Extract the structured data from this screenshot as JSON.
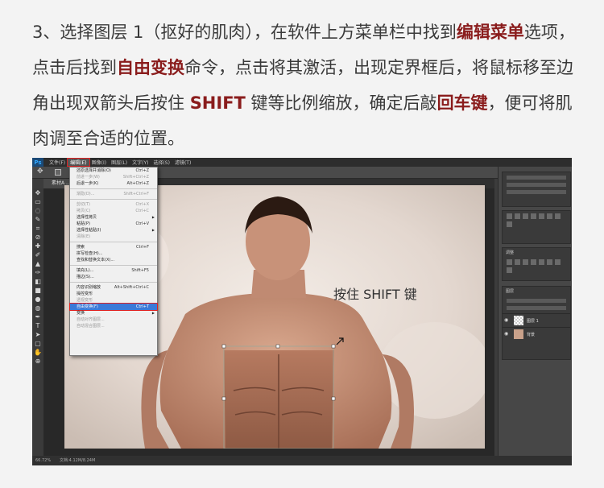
{
  "instruction": {
    "p1": "3、选择图层 1（抠好的肌肉），在软件上方菜单栏中找到",
    "h1": "编辑菜单",
    "p2": "选项，点击后找到",
    "h2": "自由变换",
    "p3": "命令，点击将其激活，出现定界框后，将鼠标移至边角出现双箭头后按住 ",
    "h3": "SHIFT",
    "p4": " 键等比例缩放，确定后敲",
    "h4": "回车键",
    "p5": "，便可将肌肉调至合适的位置。"
  },
  "ps": {
    "logo": "Ps",
    "menu": [
      "文件(F)",
      "编辑(E)",
      "图像(I)",
      "图层(L)",
      "文字(Y)",
      "选择(S)",
      "滤镜(T)"
    ],
    "doc_tab": "素材A ...",
    "annotation": "按住 SHIFT 键",
    "edit_menu": [
      {
        "label": "还原选择并消除(O)",
        "shortcut": "Ctrl+Z",
        "disabled": false
      },
      {
        "label": "前进一步(W)",
        "shortcut": "Shift+Ctrl+Z",
        "disabled": true
      },
      {
        "label": "后退一步(K)",
        "shortcut": "Alt+Ctrl+Z",
        "disabled": false
      },
      {
        "sep": true
      },
      {
        "label": "渐隐(D)...",
        "shortcut": "Shift+Ctrl+F",
        "disabled": true
      },
      {
        "sep": true
      },
      {
        "label": "剪切(T)",
        "shortcut": "Ctrl+X",
        "disabled": true
      },
      {
        "label": "拷贝(C)",
        "shortcut": "Ctrl+C",
        "disabled": true
      },
      {
        "label": "选择性拷贝",
        "shortcut": "",
        "disabled": false,
        "arrow": true
      },
      {
        "label": "粘贴(P)",
        "shortcut": "Ctrl+V",
        "disabled": false
      },
      {
        "label": "选择性粘贴(I)",
        "shortcut": "",
        "disabled": false,
        "arrow": true
      },
      {
        "label": "清除(E)",
        "shortcut": "",
        "disabled": true
      },
      {
        "sep": true
      },
      {
        "label": "搜索",
        "shortcut": "Ctrl+F",
        "disabled": false
      },
      {
        "label": "拼写检查(H)...",
        "shortcut": "",
        "disabled": false
      },
      {
        "label": "查找和替换文本(X)...",
        "shortcut": "",
        "disabled": false
      },
      {
        "sep": true
      },
      {
        "label": "填充(L)...",
        "shortcut": "Shift+F5",
        "disabled": false
      },
      {
        "label": "描边(S)...",
        "shortcut": "",
        "disabled": false
      },
      {
        "sep": true
      },
      {
        "label": "内容识别缩放",
        "shortcut": "Alt+Shift+Ctrl+C",
        "disabled": false
      },
      {
        "label": "操控变形",
        "shortcut": "",
        "disabled": false
      },
      {
        "label": "透视变形",
        "shortcut": "",
        "disabled": true
      },
      {
        "label": "自由变换(F)",
        "shortcut": "Ctrl+T",
        "disabled": false,
        "selected": true
      },
      {
        "label": "变换",
        "shortcut": "",
        "disabled": false,
        "arrow": true
      },
      {
        "label": "自动对齐图层...",
        "shortcut": "",
        "disabled": true
      },
      {
        "label": "自动混合图层...",
        "shortcut": "",
        "disabled": true
      }
    ],
    "layers": [
      {
        "name": "图层 1",
        "kind": "layer"
      },
      {
        "name": "背景",
        "kind": "bg"
      }
    ],
    "panel_title": "调整",
    "layers_tab": "图层",
    "status_zoom": "66.72%",
    "status_doc": "文档:4.12M/8.24M"
  },
  "colors": {
    "highlight": "#8a1c1c",
    "menu_select": "#3b79d8",
    "marker": "#dd2222"
  }
}
